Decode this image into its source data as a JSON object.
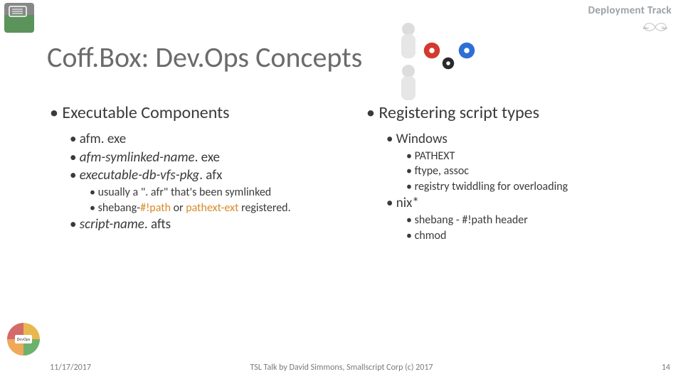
{
  "header": {
    "track_label": "Deployment Track"
  },
  "title": "Coff.Box: Dev.Ops Concepts",
  "left": {
    "heading": "Executable Components",
    "items": [
      {
        "text": "afm. exe",
        "italic": false
      },
      {
        "text": "afm-symlinked-name",
        "suffix": ". exe",
        "italic": true
      },
      {
        "text": "executable-db-vfs-pkg",
        "suffix": ". afx",
        "italic": true
      }
    ],
    "sub_items": [
      {
        "text": "usually a \". afr\" that's been symlinked"
      },
      {
        "prefix": "shebang-",
        "link1": "#!path",
        "mid": " or ",
        "link2": "pathext-ext",
        "suffix": " registered."
      }
    ],
    "last_item": {
      "text": "script-name",
      "suffix": ". afts",
      "italic": true
    }
  },
  "right": {
    "heading": "Registering script types",
    "items": [
      {
        "text": "Windows",
        "children": [
          "PATHEXT",
          "ftype, assoc",
          "registry twiddling for overloading"
        ]
      },
      {
        "text": "nix*",
        "children": [
          "shebang - #!path header",
          "chmod"
        ]
      }
    ]
  },
  "footer": {
    "date": "11/17/2017",
    "center": "TSL Talk by David Simmons, Smallscript Corp (c) 2017",
    "page": "14"
  },
  "colors": {
    "gear_red": "#d33a2f",
    "gear_black": "#2a2a2a",
    "gear_blue": "#2e6fd6",
    "link": "#d98a2a"
  },
  "badge_label": "DevOps"
}
